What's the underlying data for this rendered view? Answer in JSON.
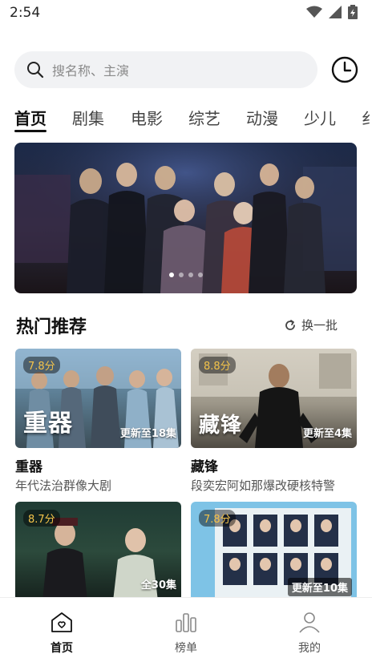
{
  "status": {
    "time": "2:54"
  },
  "search": {
    "placeholder": "搜名称、主演"
  },
  "tabs": [
    "首页",
    "剧集",
    "电影",
    "综艺",
    "动漫",
    "少儿",
    "纟"
  ],
  "banner": {
    "dots": 4,
    "active_dot": 0
  },
  "section": {
    "title": "热门推荐",
    "refresh_label": "换一批"
  },
  "cards": [
    {
      "rating": "7.8分",
      "overlay_title": "重器",
      "episode": "更新至18集",
      "title": "重器",
      "subtitle": "年代法治群像大剧"
    },
    {
      "rating": "8.8分",
      "overlay_title": "藏锋",
      "episode": "更新至4集",
      "title": "藏锋",
      "subtitle": "段奕宏阿如那爆改硬核特警"
    },
    {
      "rating": "8.7分",
      "overlay_title": "",
      "episode": "全30集",
      "title": "",
      "subtitle": ""
    },
    {
      "rating": "7.8分",
      "overlay_title": "",
      "episode": "更新至10集",
      "title": "",
      "subtitle": ""
    }
  ],
  "bottom_nav": [
    {
      "label": "首页",
      "icon": "home-icon"
    },
    {
      "label": "榜单",
      "icon": "chart-icon"
    },
    {
      "label": "我的",
      "icon": "profile-icon"
    }
  ],
  "colors": {
    "accent": "#111111",
    "rating": "#f3c34a",
    "search_bg": "#f1f2f4"
  }
}
